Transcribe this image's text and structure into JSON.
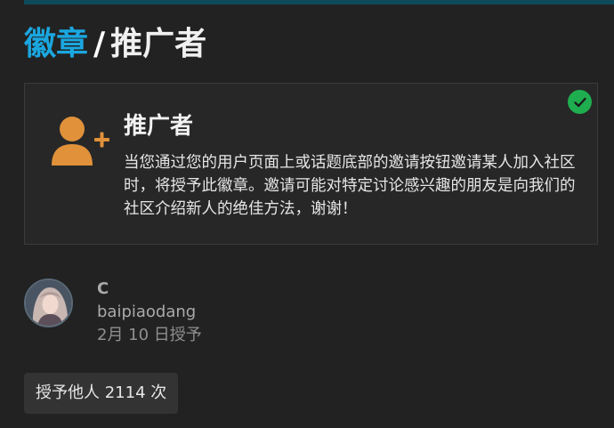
{
  "breadcrumb": {
    "parent_label": "徽章",
    "separator": "/",
    "current_label": "推广者"
  },
  "badge": {
    "title": "推广者",
    "description": "当您通过您的用户页面上或话题底部的邀请按钮邀请某人加入社区时，将授予此徽章。邀请可能对特定讨论感兴趣的朋友是向我们的社区介绍新人的绝佳方法，谢谢！",
    "icon": "user-plus-icon",
    "icon_color": "#e0913a",
    "granted": true,
    "granted_color": "#1fae4f"
  },
  "grant": {
    "display_name": "C",
    "username": "baipiaodang",
    "date": "2月 10 日授予"
  },
  "granted_count_label": "授予他人 2114 次",
  "colors": {
    "accent": "#1aa7e0",
    "background": "#222222",
    "card_background": "#272727"
  }
}
